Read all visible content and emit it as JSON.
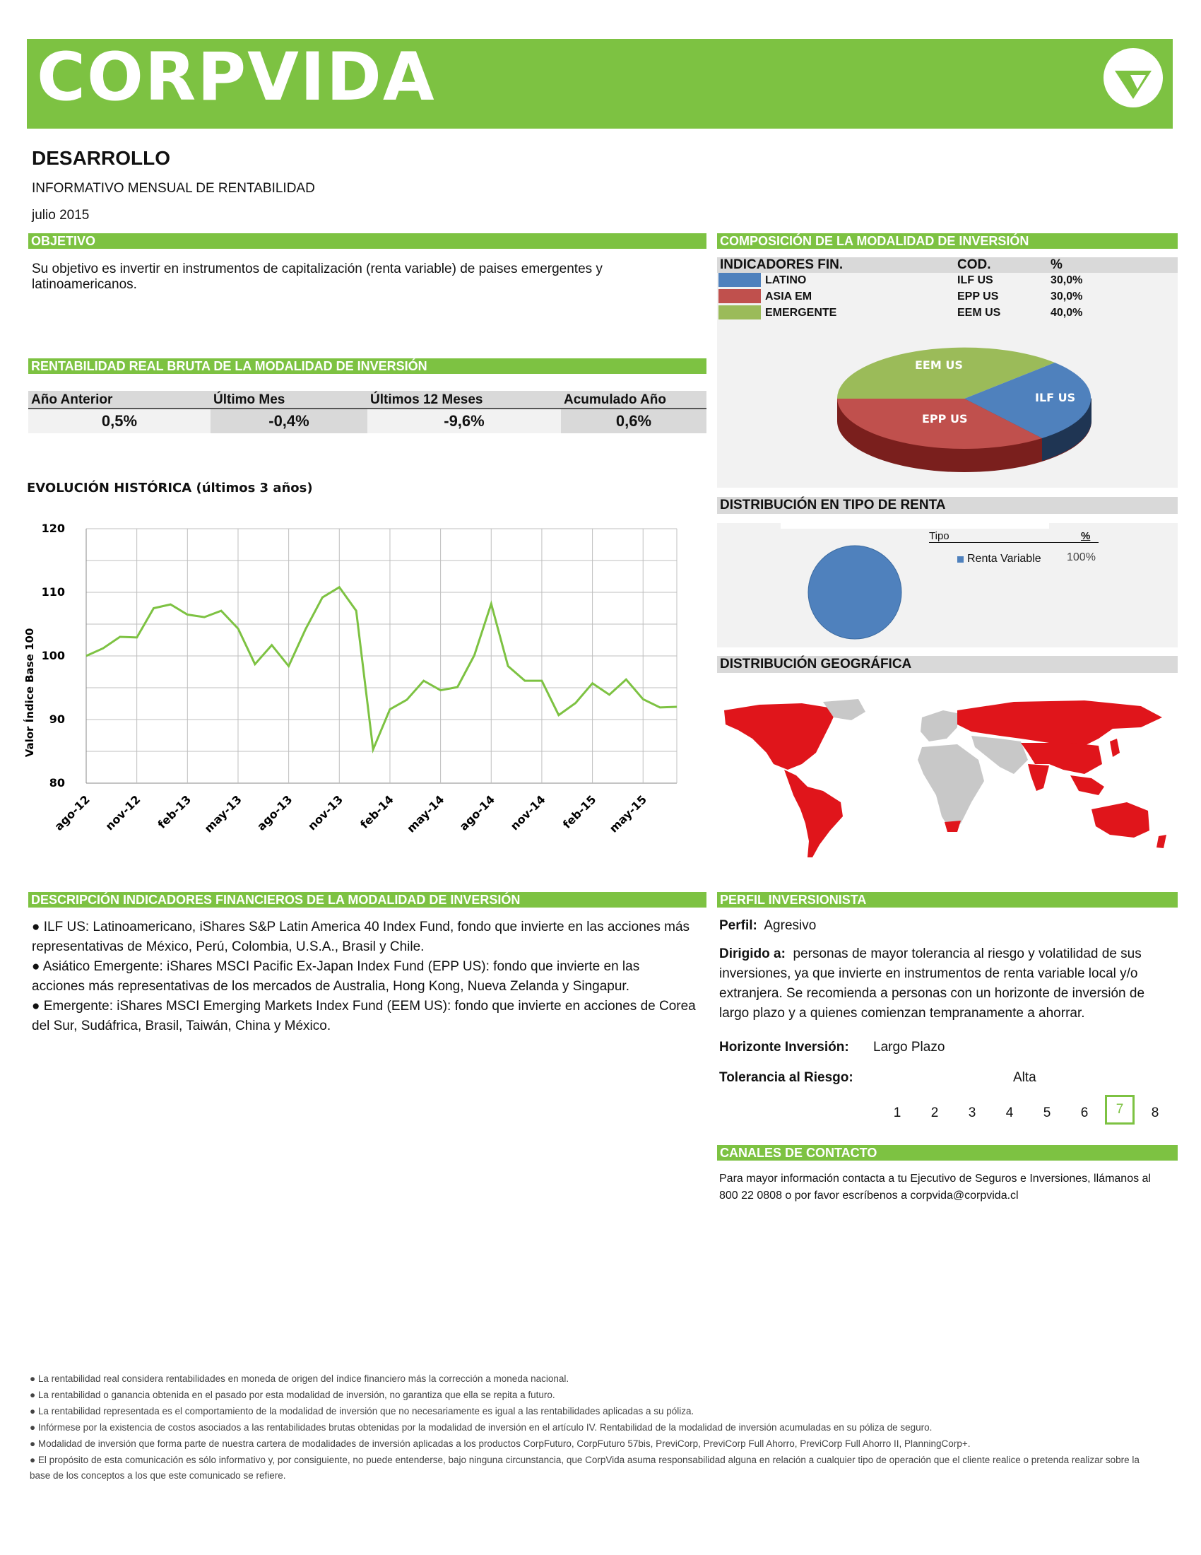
{
  "brand": {
    "name": "CORPVIDA",
    "color": "#7dc242"
  },
  "header": {
    "title": "DESARROLLO",
    "subtitle": "INFORMATIVO MENSUAL DE RENTABILIDAD",
    "date": "julio 2015"
  },
  "objetivo": {
    "heading": "OBJETIVO",
    "text": "Su objetivo es invertir en instrumentos de capitalización (renta variable) de paises emergentes y latinoamericanos."
  },
  "rentabilidad": {
    "heading": "RENTABILIDAD REAL BRUTA DE LA MODALIDAD DE INVERSIÓN",
    "columns": [
      "Año Anterior",
      "Último Mes",
      "Últimos 12 Meses",
      "Acumulado Año"
    ],
    "values": [
      "0,5%",
      "-0,4%",
      "-9,6%",
      "0,6%"
    ]
  },
  "composicion": {
    "heading": "COMPOSICIÓN DE LA MODALIDAD DE INVERSIÓN",
    "col_indicadores": "INDICADORES FIN.",
    "col_cod": "COD.",
    "col_pct": "%",
    "rows": [
      {
        "name": "LATINO",
        "cod": "ILF US",
        "pct": "30,0%",
        "color": "#4f81bd"
      },
      {
        "name": "ASIA EM",
        "cod": "EPP US",
        "pct": "30,0%",
        "color": "#c0504d"
      },
      {
        "name": "EMERGENTE",
        "cod": "EEM US",
        "pct": "40,0%",
        "color": "#9bbb59"
      }
    ],
    "pie_labels": [
      "EEM US",
      "ILF US",
      "EPP US"
    ]
  },
  "chart_data": {
    "type": "line",
    "title": "EVOLUCIÓN HISTÓRICA (últimos 3 años)",
    "ylabel": "Valor Índice Base 100",
    "ylim": [
      80,
      120
    ],
    "yticks": [
      80,
      90,
      100,
      110,
      120
    ],
    "xticklabels": [
      "ago-12",
      "nov-12",
      "feb-13",
      "may-13",
      "ago-13",
      "nov-13",
      "feb-14",
      "may-14",
      "ago-14",
      "nov-14",
      "feb-15",
      "may-15"
    ],
    "color": "#7dc242",
    "values": [
      100,
      101.2,
      103,
      102.9,
      107.5,
      108.1,
      106.5,
      106.1,
      107.1,
      104.3,
      98.7,
      101.7,
      98.4,
      104.2,
      109.2,
      110.8,
      107.1,
      85.3,
      91.6,
      93.1,
      96.1,
      94.6,
      95.1,
      100.1,
      108.2,
      98.4,
      96.1,
      96.1,
      90.7,
      92.6,
      95.7,
      93.9,
      96.3,
      93.2,
      91.9,
      92.0
    ]
  },
  "renta": {
    "heading": "DISTRIBUCIÓN EN TIPO DE RENTA",
    "col_tipo": "Tipo",
    "col_pct": "%",
    "legend": "Renta Variable",
    "value": "100%",
    "color": "#4f81bd"
  },
  "geo": {
    "heading": "DISTRIBUCIÓN GEOGRÁFICA"
  },
  "descripcion": {
    "heading": "DESCRIPCIÓN INDICADORES FINANCIEROS DE LA MODALIDAD DE INVERSIÓN",
    "items": [
      "● ILF US: Latinoamericano, iShares S&P Latin America 40 Index Fund, fondo que invierte en las acciones más representativas de México, Perú, Colombia, U.S.A., Brasil y Chile.",
      "● Asiático Emergente: iShares MSCI Pacific Ex-Japan Index Fund (EPP US): fondo que invierte en las acciones más representativas de los mercados de Australia, Hong Kong, Nueva Zelanda y Singapur.",
      "● Emergente: iShares MSCI Emerging Markets Index Fund (EEM US): fondo que invierte en acciones de Corea del Sur, Sudáfrica, Brasil, Taiwán, China y México."
    ]
  },
  "perfil": {
    "heading": "PERFIL INVERSIONISTA",
    "perfil_label": "Perfil:",
    "perfil_value": "Agresivo",
    "dirigido_label": "Dirigido a:",
    "dirigido_value": "personas de mayor tolerancia al riesgo y volatilidad de sus inversiones, ya que invierte en instrumentos de renta variable local y/o extranjera. Se recomienda a personas con un horizonte de inversión de largo plazo y a quienes comienzan tempranamente a ahorrar.",
    "horizonte_label": "Horizonte Inversión:",
    "horizonte_value": "Largo Plazo",
    "tolerancia_label": "Tolerancia al Riesgo:",
    "tolerancia_value": "Alta",
    "scale": [
      "1",
      "2",
      "3",
      "4",
      "5",
      "6",
      "7",
      "8"
    ],
    "selected": "7"
  },
  "contacto": {
    "heading": "CANALES DE CONTACTO",
    "text": "Para mayor información contacta a tu Ejecutivo de Seguros e Inversiones, llámanos al 800 22 0808 o por favor escríbenos a corpvida@corpvida.cl"
  },
  "footnotes": [
    "● La rentabilidad real considera rentabilidades en moneda de origen del índice financiero más la corrección a moneda nacional.",
    "● La rentabilidad o ganancia obtenida en el pasado por esta modalidad de inversión, no garantiza que ella se repita a futuro.",
    "● La rentabilidad representada es el comportamiento de la modalidad de inversión que no necesariamente es igual a las rentabilidades aplicadas a su póliza.",
    "● Infórmese por la existencia de costos asociados a las rentabilidades brutas obtenidas por la modalidad de inversión en el artículo IV. Rentabilidad de la modalidad de inversión acumuladas en su póliza de seguro.",
    "● Modalidad de inversión que forma parte de nuestra cartera de modalidades de inversión aplicadas a los productos CorpFuturo, CorpFuturo 57bis, PreviCorp, PreviCorp Full Ahorro, PreviCorp Full Ahorro II, PlanningCorp+.",
    "● El propósito de esta comunicación es sólo informativo y, por consiguiente, no puede entenderse, bajo ninguna circunstancia, que CorpVida asuma responsabilidad alguna en relación a cualquier tipo de operación que el cliente realice o pretenda realizar sobre la base de los conceptos a los que este comunicado se refiere."
  ]
}
